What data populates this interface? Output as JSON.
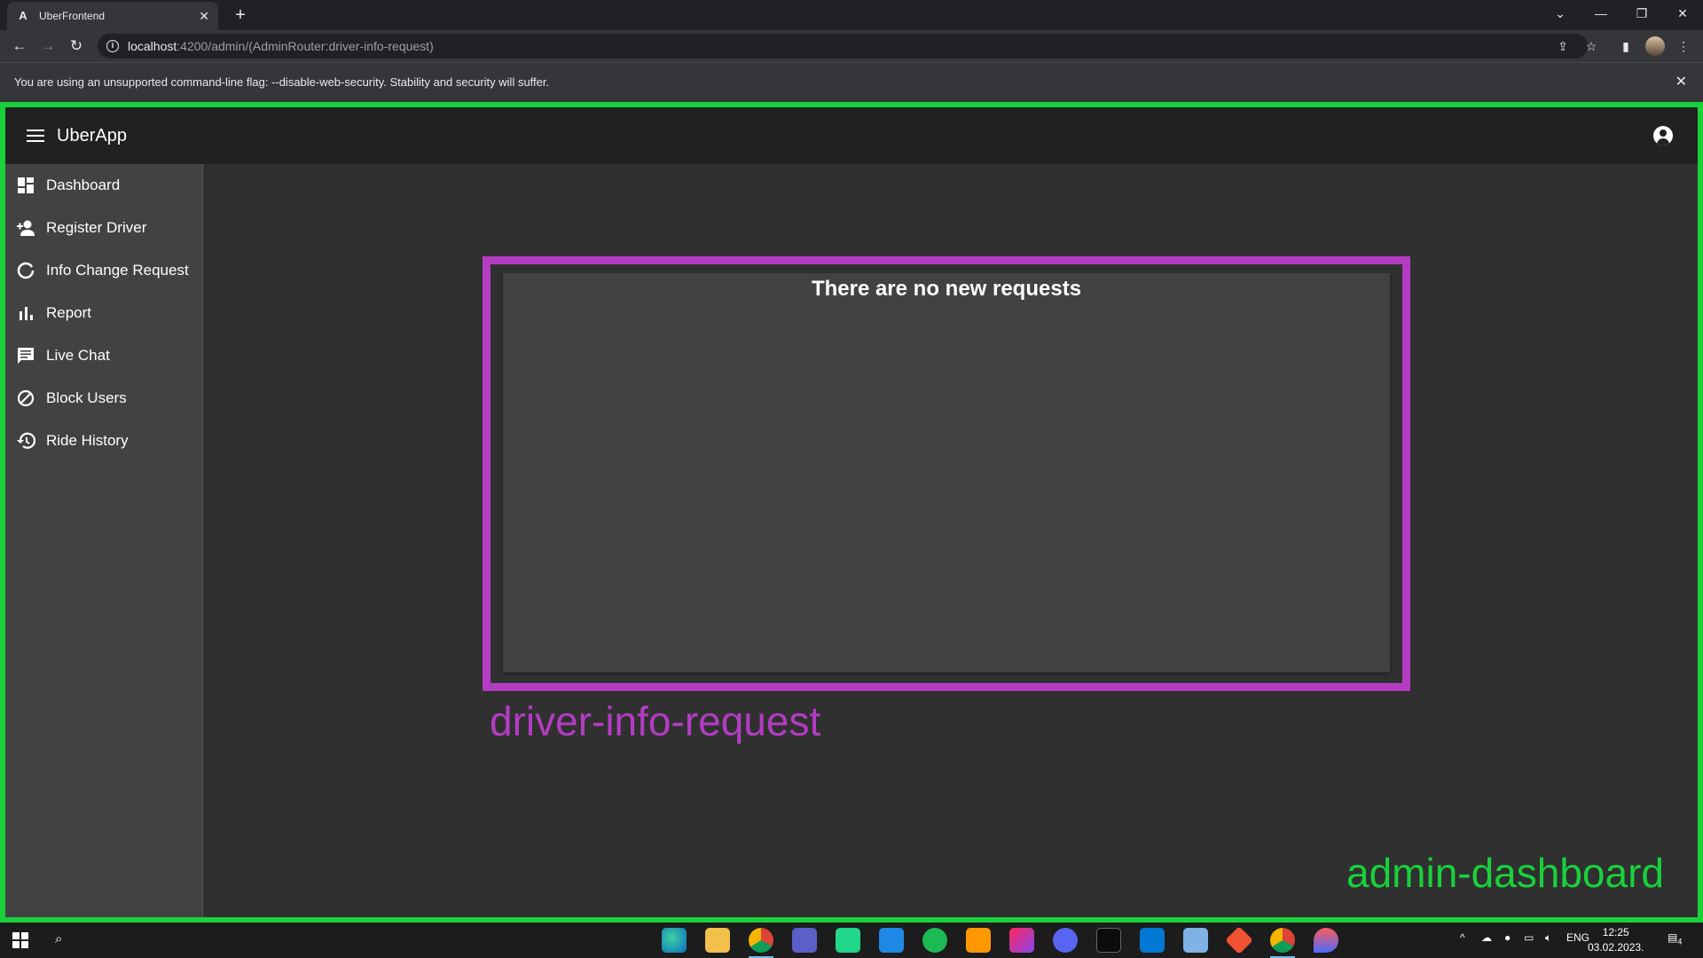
{
  "browser": {
    "tab_title": "UberFrontend",
    "tab_favicon": "A",
    "url_host": "localhost",
    "url_path": ":4200/admin/(AdminRouter:driver-info-request)",
    "warning": "You are using an unsupported command-line flag: --disable-web-security. Stability and security will suffer."
  },
  "app": {
    "title": "UberApp",
    "sidebar": [
      {
        "label": "Dashboard",
        "icon": "dashboard-icon"
      },
      {
        "label": "Register Driver",
        "icon": "person-add-icon"
      },
      {
        "label": "Info Change Request",
        "icon": "refresh-icon"
      },
      {
        "label": "Report",
        "icon": "bar-chart-icon"
      },
      {
        "label": "Live Chat",
        "icon": "chat-icon"
      },
      {
        "label": "Block Users",
        "icon": "block-icon"
      },
      {
        "label": "Ride History",
        "icon": "history-icon"
      }
    ],
    "card_message": "There are no new requests"
  },
  "annotations": {
    "inner_component": "driver-info-request",
    "outer_component": "admin-dashboard",
    "inner_color": "#b33cc3",
    "outer_color": "#19d13b"
  },
  "taskbar": {
    "language": "ENG",
    "time": "12:25",
    "date": "03.02.2023.",
    "notification_count": "4"
  }
}
